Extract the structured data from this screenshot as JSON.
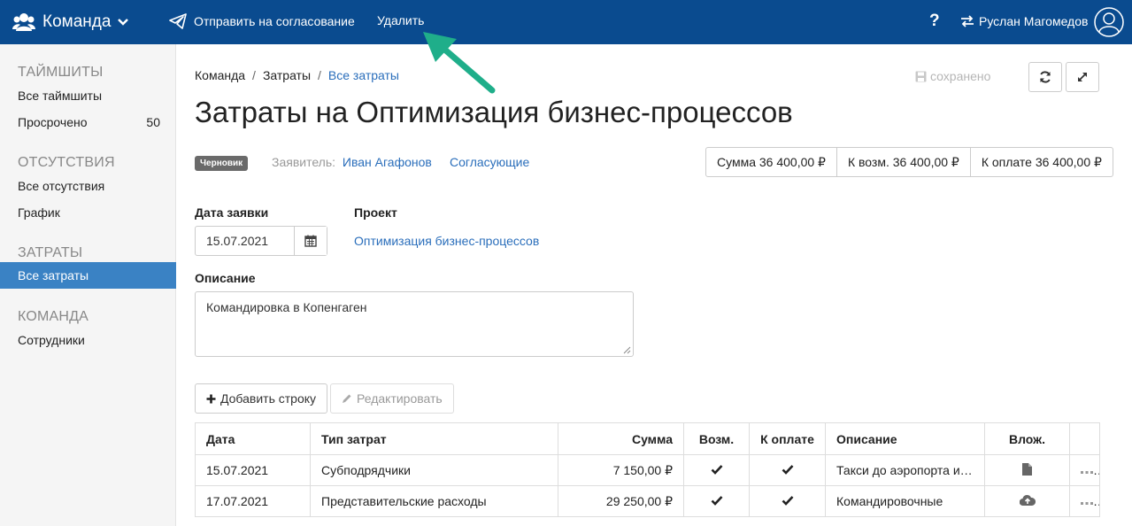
{
  "topbar": {
    "brand": "Команда",
    "send_for_approval": "Отправить на согласование",
    "delete": "Удалить",
    "help": "?",
    "user_name": "Руслан Магомедов"
  },
  "sidebar": {
    "sections": [
      {
        "title": "ТАЙМШИТЫ",
        "items": [
          {
            "label": "Все таймшиты"
          },
          {
            "label": "Просрочено",
            "count": "50"
          }
        ]
      },
      {
        "title": "ОТСУТСТВИЯ",
        "items": [
          {
            "label": "Все отсутствия"
          },
          {
            "label": "График"
          }
        ]
      },
      {
        "title": "ЗАТРАТЫ",
        "items": [
          {
            "label": "Все затраты",
            "active": true
          }
        ]
      },
      {
        "title": "КОМАНДА",
        "items": [
          {
            "label": "Сотрудники"
          }
        ]
      }
    ]
  },
  "breadcrumb": {
    "items": [
      "Команда",
      "Затраты",
      "Все затраты"
    ],
    "separator": "/"
  },
  "status": {
    "saved": "сохранено"
  },
  "page": {
    "title": "Затраты на Оптимизация бизнес-процессов",
    "badge": "Черновик",
    "applicant_label": "Заявитель:",
    "applicant_name": "Иван Агафонов",
    "approvers": "Согласующие"
  },
  "totals": {
    "sum": "Сумма 36 400,00 ₽",
    "refund": "К возм. 36 400,00 ₽",
    "to_pay": "К оплате 36 400,00 ₽"
  },
  "form": {
    "date_label": "Дата заявки",
    "date_value": "15.07.2021",
    "project_label": "Проект",
    "project_value": "Оптимизация бизнес-процессов",
    "description_label": "Описание",
    "description_value": "Командировка в Копенгаген"
  },
  "actions": {
    "add_row": "Добавить строку",
    "edit": "Редактировать"
  },
  "table": {
    "columns": [
      "Дата",
      "Тип затрат",
      "Сумма",
      "Возм.",
      "К оплате",
      "Описание",
      "Влож."
    ],
    "rows": [
      {
        "date": "15.07.2021",
        "type": "Субподрядчики",
        "amount": "7 150,00 ₽",
        "refund": true,
        "to_pay": true,
        "description": "Такси до аэропорта и ...",
        "attachment": "file-icon"
      },
      {
        "date": "17.07.2021",
        "type": "Представительские расходы",
        "amount": "29 250,00 ₽",
        "refund": true,
        "to_pay": true,
        "description": "Командировочные",
        "attachment": "cloud-upload-icon"
      }
    ]
  },
  "colors": {
    "navbar": "#0a4b8f",
    "active_item": "#3a82c4",
    "link": "#2a6ebb",
    "annotation_arrow": "#1fae8a"
  }
}
